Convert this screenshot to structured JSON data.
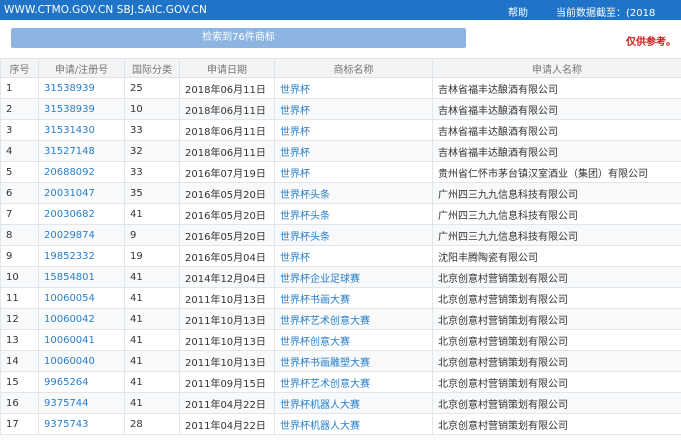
{
  "header": {
    "site": "WWW.CTMO.GOV.CN SBJ.SAIC.GOV.CN",
    "help": "帮助",
    "current_data": "当前数据截至：(2018"
  },
  "search": {
    "button_label": "检索到76件商标",
    "note": "仅供参考。"
  },
  "columns": [
    "序号",
    "申请/注册号",
    "国际分类",
    "申请日期",
    "商标名称",
    "申请人名称"
  ],
  "rows": [
    {
      "idx": "1",
      "reg": "31538939",
      "cls": "25",
      "date": "2018年06月11日",
      "name": "世界杯",
      "applicant": "吉林省福丰达酿酒有限公司"
    },
    {
      "idx": "2",
      "reg": "31538939",
      "cls": "10",
      "date": "2018年06月11日",
      "name": "世界杯",
      "applicant": "吉林省福丰达酿酒有限公司"
    },
    {
      "idx": "3",
      "reg": "31531430",
      "cls": "33",
      "date": "2018年06月11日",
      "name": "世界杯",
      "applicant": "吉林省福丰达酿酒有限公司"
    },
    {
      "idx": "4",
      "reg": "31527148",
      "cls": "32",
      "date": "2018年06月11日",
      "name": "世界杯",
      "applicant": "吉林省福丰达酿酒有限公司"
    },
    {
      "idx": "5",
      "reg": "20688092",
      "cls": "33",
      "date": "2016年07月19日",
      "name": "世界杯",
      "applicant": "贵州省仁怀市茅台镇汉室酒业（集团）有限公司"
    },
    {
      "idx": "6",
      "reg": "20031047",
      "cls": "35",
      "date": "2016年05月20日",
      "name": "世界杯头条",
      "applicant": "广州四三九九信息科技有限公司"
    },
    {
      "idx": "7",
      "reg": "20030682",
      "cls": "41",
      "date": "2016年05月20日",
      "name": "世界杯头条",
      "applicant": "广州四三九九信息科技有限公司"
    },
    {
      "idx": "8",
      "reg": "20029874",
      "cls": "9",
      "date": "2016年05月20日",
      "name": "世界杯头条",
      "applicant": "广州四三九九信息科技有限公司"
    },
    {
      "idx": "9",
      "reg": "19852332",
      "cls": "19",
      "date": "2016年05月04日",
      "name": "世界杯",
      "applicant": "沈阳丰腾陶瓷有限公司"
    },
    {
      "idx": "10",
      "reg": "15854801",
      "cls": "41",
      "date": "2014年12月04日",
      "name": "世界杯企业足球赛",
      "applicant": "北京创意村营销策划有限公司"
    },
    {
      "idx": "11",
      "reg": "10060054",
      "cls": "41",
      "date": "2011年10月13日",
      "name": "世界杯书画大赛",
      "applicant": "北京创意村营销策划有限公司"
    },
    {
      "idx": "12",
      "reg": "10060042",
      "cls": "41",
      "date": "2011年10月13日",
      "name": "世界杯艺术创意大赛",
      "applicant": "北京创意村营销策划有限公司"
    },
    {
      "idx": "13",
      "reg": "10060041",
      "cls": "41",
      "date": "2011年10月13日",
      "name": "世界杯创意大赛",
      "applicant": "北京创意村营销策划有限公司"
    },
    {
      "idx": "14",
      "reg": "10060040",
      "cls": "41",
      "date": "2011年10月13日",
      "name": "世界杯书画雕塑大赛",
      "applicant": "北京创意村营销策划有限公司"
    },
    {
      "idx": "15",
      "reg": "9965264",
      "cls": "41",
      "date": "2011年09月15日",
      "name": "世界杯艺术创意大赛",
      "applicant": "北京创意村营销策划有限公司"
    },
    {
      "idx": "16",
      "reg": "9375744",
      "cls": "41",
      "date": "2011年04月22日",
      "name": "世界杯机器人大赛",
      "applicant": "北京创意村营销策划有限公司"
    },
    {
      "idx": "17",
      "reg": "9375743",
      "cls": "28",
      "date": "2011年04月22日",
      "name": "世界杯机器人大赛",
      "applicant": "北京创意村营销策划有限公司"
    }
  ]
}
